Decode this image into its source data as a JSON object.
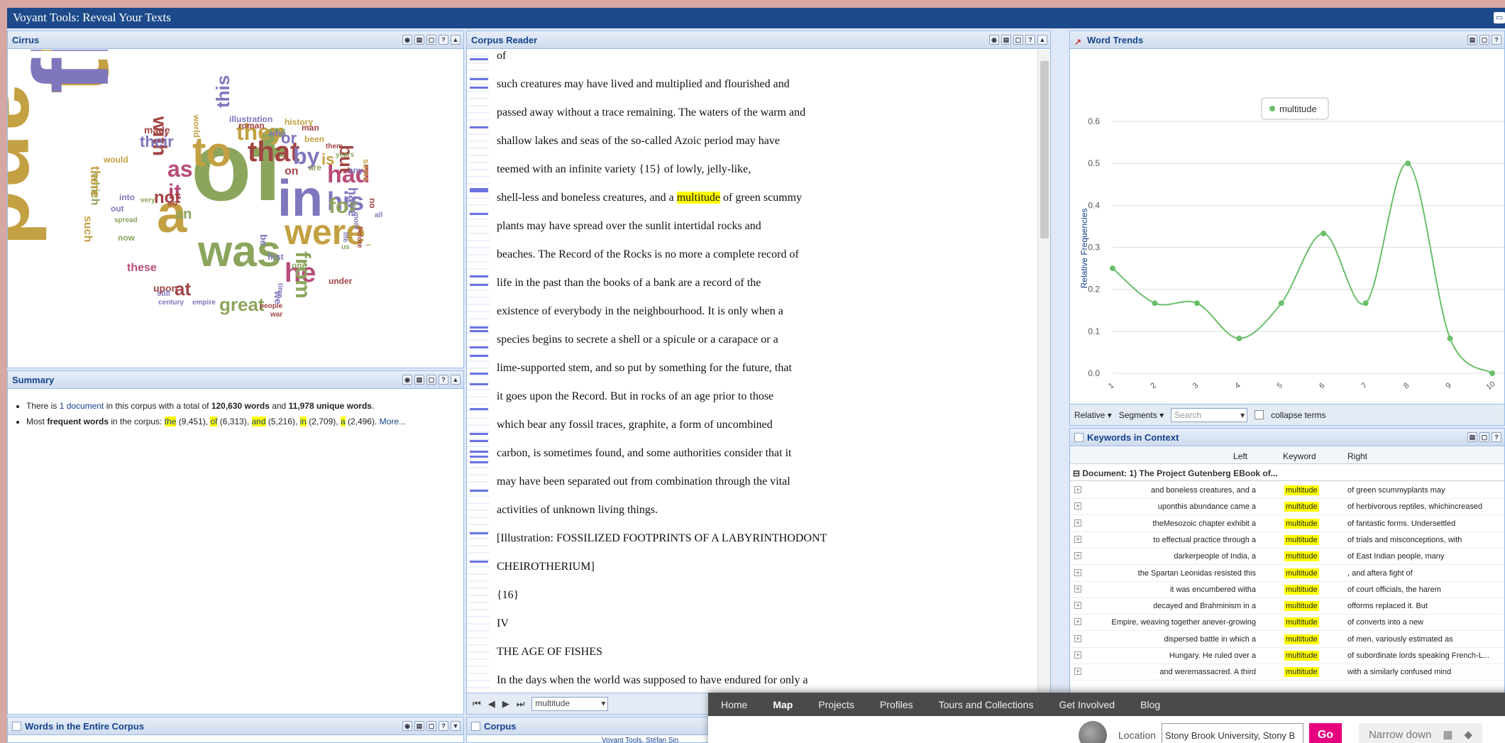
{
  "app": {
    "title": "Voyant Tools: Reveal Your Texts"
  },
  "cirrus": {
    "title": "Cirrus",
    "words": [
      {
        "t": "the",
        "c": "#c3a042"
      },
      {
        "t": "and",
        "c": "#c3a042"
      },
      {
        "t": "of",
        "c": "#8ca55d"
      },
      {
        "t": "in",
        "c": "#7f77bd"
      },
      {
        "t": "a",
        "c": "#c3a042"
      },
      {
        "t": "was",
        "c": "#8ca55d"
      },
      {
        "t": "to",
        "c": "#c3a042"
      },
      {
        "t": "that",
        "c": "#a24444"
      },
      {
        "t": "were",
        "c": "#c3a042"
      },
      {
        "t": "he",
        "c": "#b84c7a"
      },
      {
        "t": "his",
        "c": "#7f77bd"
      },
      {
        "t": "had",
        "c": "#b84c7a"
      },
      {
        "t": "great",
        "c": "#8ca55d"
      },
      {
        "t": "at",
        "c": "#a24444"
      },
      {
        "t": "as",
        "c": "#b84c7a"
      },
      {
        "t": "by",
        "c": "#7f77bd"
      },
      {
        "t": "they",
        "c": "#c3a042"
      },
      {
        "t": "with",
        "c": "#a24444"
      },
      {
        "t": "this",
        "c": "#7f77bd"
      },
      {
        "t": "from",
        "c": "#8ca55d"
      },
      {
        "t": "for",
        "c": "#8ca55d"
      },
      {
        "t": "it",
        "c": "#b84c7a"
      },
      {
        "t": "not",
        "c": "#a24444"
      },
      {
        "t": "but",
        "c": "#a24444"
      },
      {
        "t": "their",
        "c": "#7f77bd"
      },
      {
        "t": "these",
        "c": "#b84c7a"
      },
      {
        "t": "is",
        "c": "#c3a042"
      },
      {
        "t": "or",
        "c": "#7f77bd"
      },
      {
        "t": "have",
        "c": "#7f77bd"
      },
      {
        "t": "an",
        "c": "#8ca55d"
      },
      {
        "t": "which",
        "c": "#8ca55d"
      },
      {
        "t": "there",
        "c": "#c3a042"
      },
      {
        "t": "made",
        "c": "#a24444"
      },
      {
        "t": "illustration",
        "c": "#7f77bd"
      },
      {
        "t": "roman",
        "c": "#a24444"
      },
      {
        "t": "history",
        "c": "#c3a042"
      },
      {
        "t": "who",
        "c": "#7f77bd"
      },
      {
        "t": "world",
        "c": "#c3a042"
      },
      {
        "t": "man",
        "c": "#a24444"
      },
      {
        "t": "been",
        "c": "#c3a042"
      },
      {
        "t": "them",
        "c": "#a24444"
      },
      {
        "t": "years",
        "c": "#8ca55d"
      },
      {
        "t": "on",
        "c": "#a24444"
      },
      {
        "t": "are",
        "c": "#8ca55d"
      },
      {
        "t": "would",
        "c": "#c3a042"
      },
      {
        "t": "into",
        "c": "#7f77bd"
      },
      {
        "t": "very",
        "c": "#8ca55d"
      },
      {
        "t": "so",
        "c": "#a24444"
      },
      {
        "t": "now",
        "c": "#8ca55d"
      },
      {
        "t": "upon",
        "c": "#a24444"
      },
      {
        "t": "still",
        "c": "#7f77bd"
      },
      {
        "t": "century",
        "c": "#7f77bd"
      },
      {
        "t": "empire",
        "c": "#7f77bd"
      },
      {
        "t": "people",
        "c": "#a24444"
      },
      {
        "t": "we",
        "c": "#7f77bd"
      },
      {
        "t": "one",
        "c": "#8ca55d"
      },
      {
        "t": "first",
        "c": "#7f77bd"
      },
      {
        "t": "be",
        "c": "#7f77bd"
      },
      {
        "t": "under",
        "c": "#a24444"
      },
      {
        "t": "before",
        "c": "#a24444"
      },
      {
        "t": "more",
        "c": "#7f77bd"
      },
      {
        "t": "all",
        "c": "#7f77bd"
      },
      {
        "t": "any",
        "c": "#7f77bd"
      },
      {
        "t": "war",
        "c": "#a24444"
      },
      {
        "t": "its",
        "c": "#8ca55d"
      },
      {
        "t": "some",
        "c": "#c3a042"
      },
      {
        "t": "time",
        "c": "#7f77bd"
      },
      {
        "t": "life",
        "c": "#7f77bd"
      },
      {
        "t": "no",
        "c": "#a24444"
      },
      {
        "t": "us",
        "c": "#8ca55d"
      },
      {
        "t": "i",
        "c": "#c3a042"
      },
      {
        "t": "such",
        "c": "#c3a042"
      },
      {
        "t": "out",
        "c": "#7f77bd"
      },
      {
        "t": "spread",
        "c": "#8ca55d"
      },
      {
        "t": "first",
        "c": "#7f77bd"
      }
    ]
  },
  "summary": {
    "title": "Summary",
    "l1_a": "There is ",
    "l1_link": "1 document",
    "l1_b": " in this corpus with a total of ",
    "l1_words": "120,630 words",
    "l1_c": " and ",
    "l1_unique": "11,978 unique words",
    "l1_d": ".",
    "l2_a": "Most ",
    "l2_bold": "frequent words",
    "l2_b": " in the corpus: ",
    "freq": [
      {
        "w": "the",
        "n": " (9,451), "
      },
      {
        "w": "of",
        "n": " (6,313), "
      },
      {
        "w": "and",
        "n": " (5,216), "
      },
      {
        "w": "in",
        "n": " (2,709), "
      },
      {
        "w": "a",
        "n": " (2,496). "
      }
    ],
    "more": "More..."
  },
  "words_panel": {
    "title": "Words in the Entire Corpus"
  },
  "reader": {
    "title": "Corpus Reader",
    "lines": [
      "of",
      "such creatures may have lived and multiplied and flourished and",
      "passed away without a trace remaining. The waters of the warm and",
      "shallow lakes and seas of the so-called Azoic period may have",
      "teemed with an infinite variety {15} of lowly, jelly-like,",
      "",
      "plants may have spread over the sunlit intertidal rocks and",
      "beaches. The Record of the Rocks is no more a complete record of",
      "life in the past than the books of a bank are a record of the",
      "existence of everybody in the neighbourhood. It is only when a",
      "species begins to secrete a shell or a spicule or a carapace or a",
      "lime-supported stem, and so put by something for the future, that",
      "it goes upon the Record. But in rocks of an age prior to those",
      "which bear any fossil traces, graphite, a form of uncombined",
      "carbon, is sometimes found, and some authorities consider that it",
      "may have been separated out from combination through the vital",
      "activities of unknown living things.",
      "[Illustration: FOSSILIZED FOOTPRINTS OF A LABYRINTHODONT",
      "CHEIROTHERIUM]",
      "{16}",
      "IV",
      "THE AGE OF FISHES",
      "In the days when the world was supposed to have endured for only a"
    ],
    "hl_line": {
      "pre": "shell-less and boneless creatures, and a ",
      "term": "multitude",
      "post": " of green scummy"
    },
    "term_select": "multitude"
  },
  "corpus_panel": {
    "title": "Corpus",
    "credit": "Voyant Tools, Stéfan Sin"
  },
  "trends": {
    "title": "Word Trends",
    "legend": "multitude",
    "ylabel": "Relative Frequencies",
    "toolbar": {
      "relative": "Relative",
      "segments": "Segments",
      "search_placeholder": "Search",
      "collapse": "collapse terms"
    }
  },
  "chart_data": {
    "type": "line",
    "x": [
      1,
      2,
      3,
      4,
      5,
      6,
      7,
      8,
      9,
      10
    ],
    "series": [
      {
        "name": "multitude",
        "values": [
          0.25,
          0.167,
          0.167,
          0.083,
          0.167,
          0.333,
          0.167,
          0.5,
          0.083,
          0.0
        ]
      }
    ],
    "ylim": [
      0,
      0.6
    ],
    "yticks": [
      "0.0",
      "0.1",
      "0.2",
      "0.3",
      "0.4",
      "0.5",
      "0.6"
    ],
    "xticks": [
      "1",
      "2",
      "3",
      "4",
      "5",
      "6",
      "7",
      "8",
      "9",
      "10"
    ],
    "ylabel": "Relative Frequencies",
    "color": "#6abf6a",
    "grid": true,
    "legend": "top"
  },
  "kwic": {
    "title": "Keywords in Context",
    "col_left": "Left",
    "col_keyword": "Keyword",
    "col_right": "Right",
    "group": "Document: 1) The Project Gutenberg EBook of...",
    "rows": [
      {
        "l": "and boneless creatures, and a",
        "k": "multitude",
        "r": "of green scummyplants may"
      },
      {
        "l": "uponthis abundance came a",
        "k": "multitude",
        "r": "of herbivorous reptiles, whichincreased"
      },
      {
        "l": "theMesozoic chapter exhibit a",
        "k": "multitude",
        "r": "of fantastic forms. Undersettled"
      },
      {
        "l": "to effectual practice through a",
        "k": "multitude",
        "r": "of trials and misconceptions, with"
      },
      {
        "l": "darkerpeople of India, a",
        "k": "multitude",
        "r": "of East Indian people, many"
      },
      {
        "l": "the Spartan Leonidas resisted this",
        "k": "multitude",
        "r": ", and aftera fight of"
      },
      {
        "l": "it was encumbered witha",
        "k": "multitude",
        "r": "of court officials, the harem"
      },
      {
        "l": "decayed and Brahminism in a",
        "k": "multitude",
        "r": "offorms replaced it. But"
      },
      {
        "l": "Empire, weaving together anever-growing",
        "k": "multitude",
        "r": "of converts into a new"
      },
      {
        "l": "dispersed battle in which a",
        "k": "multitude",
        "r": "of men, variously estimated as"
      },
      {
        "l": "Hungary. He ruled over a",
        "k": "multitude",
        "r": "of subordinate lords speaking French-L..."
      },
      {
        "l": "and weremassacred. A third",
        "k": "multitude",
        "r": "with a similarly confused mind"
      }
    ]
  },
  "overlay": {
    "nav": [
      "Home",
      "Map",
      "Projects",
      "Profiles",
      "Tours and Collections",
      "Get Involved",
      "Blog"
    ],
    "location_label": "Location",
    "location_value": "Stony Brook University, Stony B",
    "go": "Go",
    "narrow": "Narrow down"
  }
}
